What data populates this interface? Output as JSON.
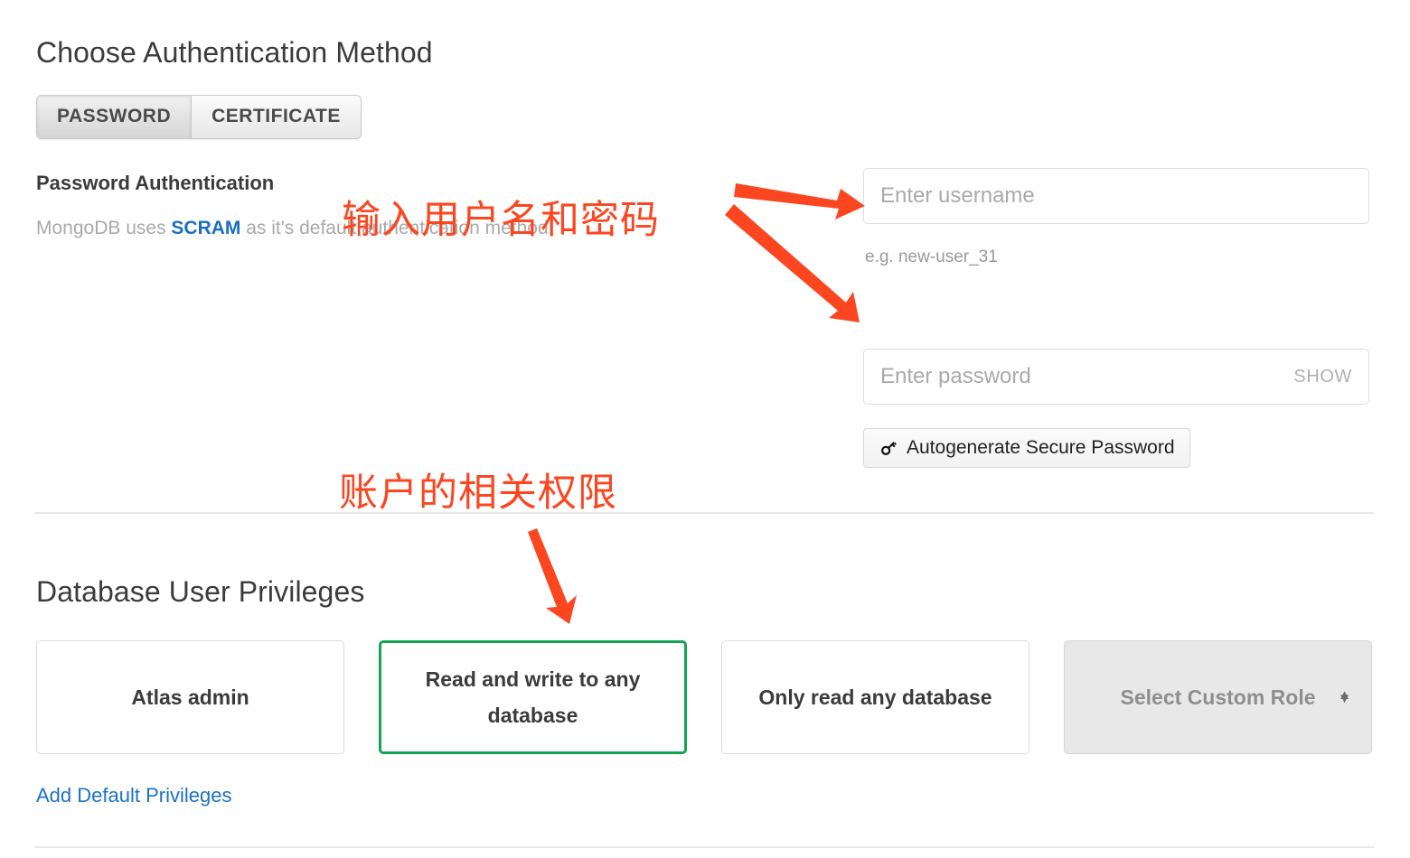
{
  "auth_section": {
    "title": "Choose Authentication Method",
    "tabs": [
      {
        "label": "PASSWORD",
        "selected": true
      },
      {
        "label": "CERTIFICATE",
        "selected": false
      }
    ],
    "password_auth": {
      "heading": "Password Authentication",
      "description_prefix": "MongoDB uses ",
      "description_link": "SCRAM",
      "description_suffix": " as it's default authentication method."
    },
    "username": {
      "placeholder": "Enter username",
      "value": "",
      "hint": "e.g. new-user_31"
    },
    "password": {
      "placeholder": "Enter password",
      "value": "",
      "show_label": "SHOW"
    },
    "autogenerate_button": {
      "label": "Autogenerate Secure Password",
      "icon": "key-icon"
    }
  },
  "privileges_section": {
    "title": "Database User Privileges",
    "cards": [
      {
        "label": "Atlas admin",
        "selected": false,
        "type": "option"
      },
      {
        "label": "Read and write to any database",
        "selected": true,
        "type": "option"
      },
      {
        "label": "Only read any database",
        "selected": false,
        "type": "option"
      },
      {
        "label": "Select Custom Role",
        "selected": false,
        "type": "dropdown"
      }
    ],
    "add_default_link": "Add Default Privileges"
  },
  "annotations": {
    "colors": {
      "annotation_red": "#fb4620",
      "selected_green": "#13a452",
      "link_blue": "#1b72c4"
    },
    "texts": [
      {
        "text": "输入用户名和密码"
      },
      {
        "text": "账户的相关权限"
      }
    ]
  }
}
